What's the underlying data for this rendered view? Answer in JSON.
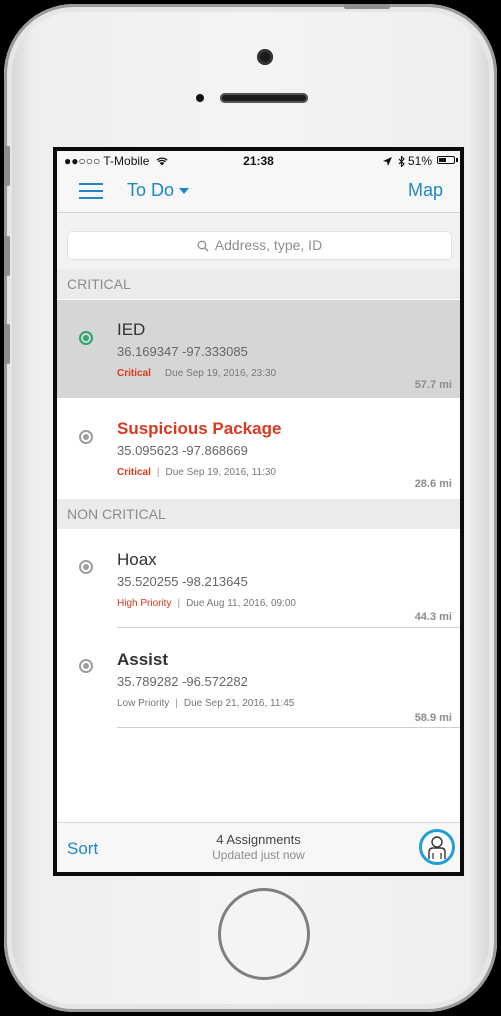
{
  "status_bar": {
    "carrier": "●●○○○ T-Mobile",
    "time": "21:38",
    "battery": "51%",
    "battery_level": 0.51
  },
  "nav": {
    "title": "To Do",
    "map_label": "Map"
  },
  "search": {
    "placeholder": "Address, type, ID"
  },
  "sections": {
    "critical": "CRITICAL",
    "non_critical": "NON CRITICAL"
  },
  "assignments": [
    {
      "title": "IED",
      "coords": "36.169347  -97.333085",
      "priority": "Critical",
      "due": "Due Sep 19, 2016, 23:30",
      "distance": "57.7 mi"
    },
    {
      "title": "Suspicious Package",
      "coords": "35.095623  -97.868669",
      "priority": "Critical",
      "due": "Due Sep 19, 2016, 11:30",
      "distance": "28.6 mi"
    },
    {
      "title": "Hoax",
      "coords": "35.520255  -98.213645",
      "priority": "High Priority",
      "due": "Due Aug 11, 2016, 09:00",
      "distance": "44.3 mi"
    },
    {
      "title": "Assist",
      "coords": "35.789282  -96.572282",
      "priority": "Low Priority",
      "due": "Due Sep 21, 2016, 11:45",
      "distance": "58.9 mi"
    }
  ],
  "toolbar": {
    "sort_label": "Sort",
    "count": "4 Assignments",
    "updated": "Updated just now"
  },
  "colors": {
    "accent": "#1e88c7",
    "critical": "#d9391e",
    "selected_radio": "#2fa56b"
  }
}
